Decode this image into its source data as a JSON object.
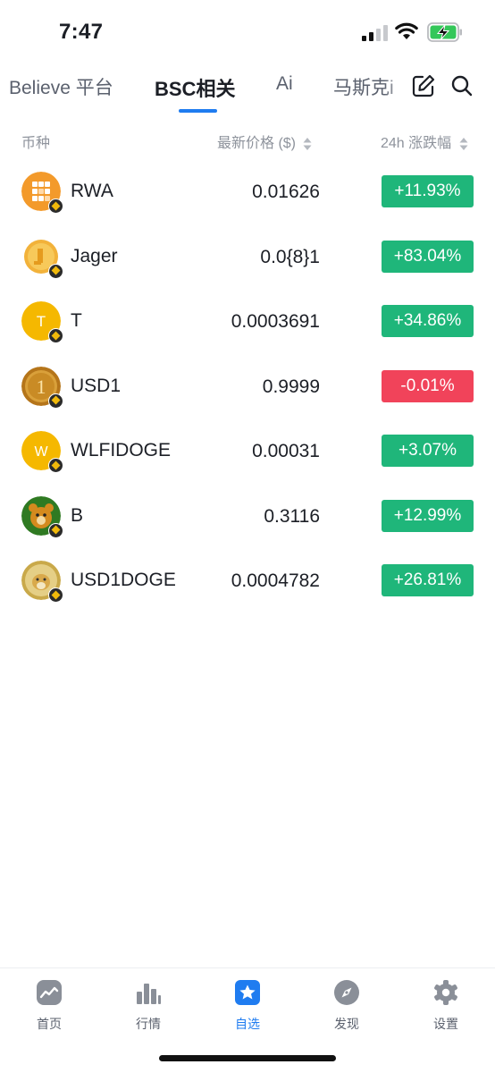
{
  "status_bar": {
    "time": "7:47"
  },
  "tabs": [
    {
      "label": "Believe 平台",
      "active": false
    },
    {
      "label": "BSC相关",
      "active": true
    },
    {
      "label": "Ai",
      "active": false
    },
    {
      "label": "马斯克i",
      "active": false
    }
  ],
  "header": {
    "coin": "币种",
    "price": "最新价格 ($)",
    "change": "24h 涨跌幅"
  },
  "coins": [
    {
      "name": "RWA",
      "price": "0.01626",
      "change": "+11.93%",
      "direction": "up"
    },
    {
      "name": "Jager",
      "price": "0.0{8}1",
      "change": "+83.04%",
      "direction": "up"
    },
    {
      "name": "T",
      "price": "0.0003691",
      "change": "+34.86%",
      "direction": "up"
    },
    {
      "name": "USD1",
      "price": "0.9999",
      "change": "-0.01%",
      "direction": "down"
    },
    {
      "name": "WLFIDOGE",
      "price": "0.00031",
      "change": "+3.07%",
      "direction": "up"
    },
    {
      "name": "B",
      "price": "0.3116",
      "change": "+12.99%",
      "direction": "up"
    },
    {
      "name": "USD1DOGE",
      "price": "0.0004782",
      "change": "+26.81%",
      "direction": "up"
    }
  ],
  "nav": [
    {
      "label": "首页",
      "icon": "home-chart-icon",
      "active": false
    },
    {
      "label": "行情",
      "icon": "bar-chart-icon",
      "active": false
    },
    {
      "label": "自选",
      "icon": "star-icon",
      "active": true
    },
    {
      "label": "发现",
      "icon": "compass-icon",
      "active": false
    },
    {
      "label": "设置",
      "icon": "gear-icon",
      "active": false
    }
  ],
  "colors": {
    "accent": "#1f7cf0",
    "up": "#1fb67a",
    "down": "#f1435a",
    "muted": "#8e939c"
  }
}
